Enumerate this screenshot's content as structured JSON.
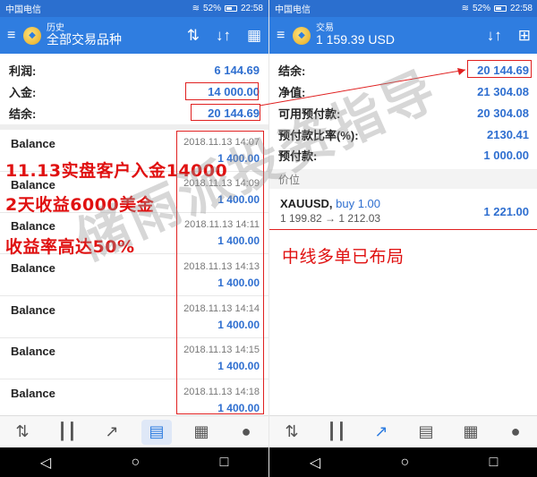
{
  "colors": {
    "statusbar": "#2b6fcf",
    "appbar": "#2f7de0",
    "value_blue": "#2f6fd0",
    "annotation_red": "#e01010"
  },
  "left": {
    "statusbar": {
      "carrier": "中国电信",
      "battery": "52%",
      "time": "22:58"
    },
    "appbar": {
      "subtitle": "历史",
      "title": "全部交易品种",
      "icons": [
        "menu-icon",
        "app-logo-icon",
        "sort-icon",
        "sort-arrows-icon",
        "calendar-icon"
      ]
    },
    "summary": [
      {
        "label": "利润:",
        "value": "6 144.69"
      },
      {
        "label": "入金:",
        "value": "14 000.00"
      },
      {
        "label": "结余:",
        "value": "20 144.69"
      }
    ],
    "items": [
      {
        "name": "Balance",
        "time": "2018.11.13 14:07",
        "amount": "1 400.00"
      },
      {
        "name": "Balance",
        "time": "2018.11.13 14:09",
        "amount": "1 400.00"
      },
      {
        "name": "Balance",
        "time": "2018.11.13 14:11",
        "amount": "1 400.00"
      },
      {
        "name": "Balance",
        "time": "2018.11.13 14:13",
        "amount": "1 400.00"
      },
      {
        "name": "Balance",
        "time": "2018.11.13 14:14",
        "amount": "1 400.00"
      },
      {
        "name": "Balance",
        "time": "2018.11.13 14:15",
        "amount": "1 400.00"
      },
      {
        "name": "Balance",
        "time": "2018.11.13 14:18",
        "amount": "1 400.00"
      }
    ],
    "captions": [
      "11.13实盘客户入金14000",
      "2天收益6000美金",
      "收益率高达50%"
    ],
    "bottomnav": [
      "quotes-icon",
      "chart-icon",
      "trade-icon",
      "history-icon",
      "news-icon",
      "chat-icon"
    ]
  },
  "right": {
    "statusbar": {
      "carrier": "中国电信",
      "battery": "52%",
      "time": "22:58"
    },
    "appbar": {
      "subtitle": "交易",
      "title": "1 159.39 USD",
      "icons": [
        "menu-icon",
        "app-logo-icon",
        "sort-arrows-icon",
        "new-order-icon"
      ]
    },
    "account": [
      {
        "label": "结余:",
        "value": "20 144.69"
      },
      {
        "label": "净值:",
        "value": "21 304.08"
      },
      {
        "label": "可用预付款:",
        "value": "20 304.08"
      },
      {
        "label": "预付款比率(%):",
        "value": "2130.41"
      },
      {
        "label": "预付款:",
        "value": "1 000.00"
      }
    ],
    "positions_header": "价位",
    "position": {
      "symbol": "XAUUSD,",
      "direction": "buy 1.00",
      "prices": "1 199.82 → 1 212.03",
      "profit": "1 221.00"
    },
    "caption": "中线多单已布局",
    "bottomnav": [
      "quotes-icon",
      "chart-icon",
      "trade-icon",
      "history-icon",
      "news-icon",
      "chat-icon"
    ]
  },
  "sysbar": [
    "back-icon",
    "home-icon",
    "recents-icon"
  ],
  "watermark": "储雨派投资指导"
}
